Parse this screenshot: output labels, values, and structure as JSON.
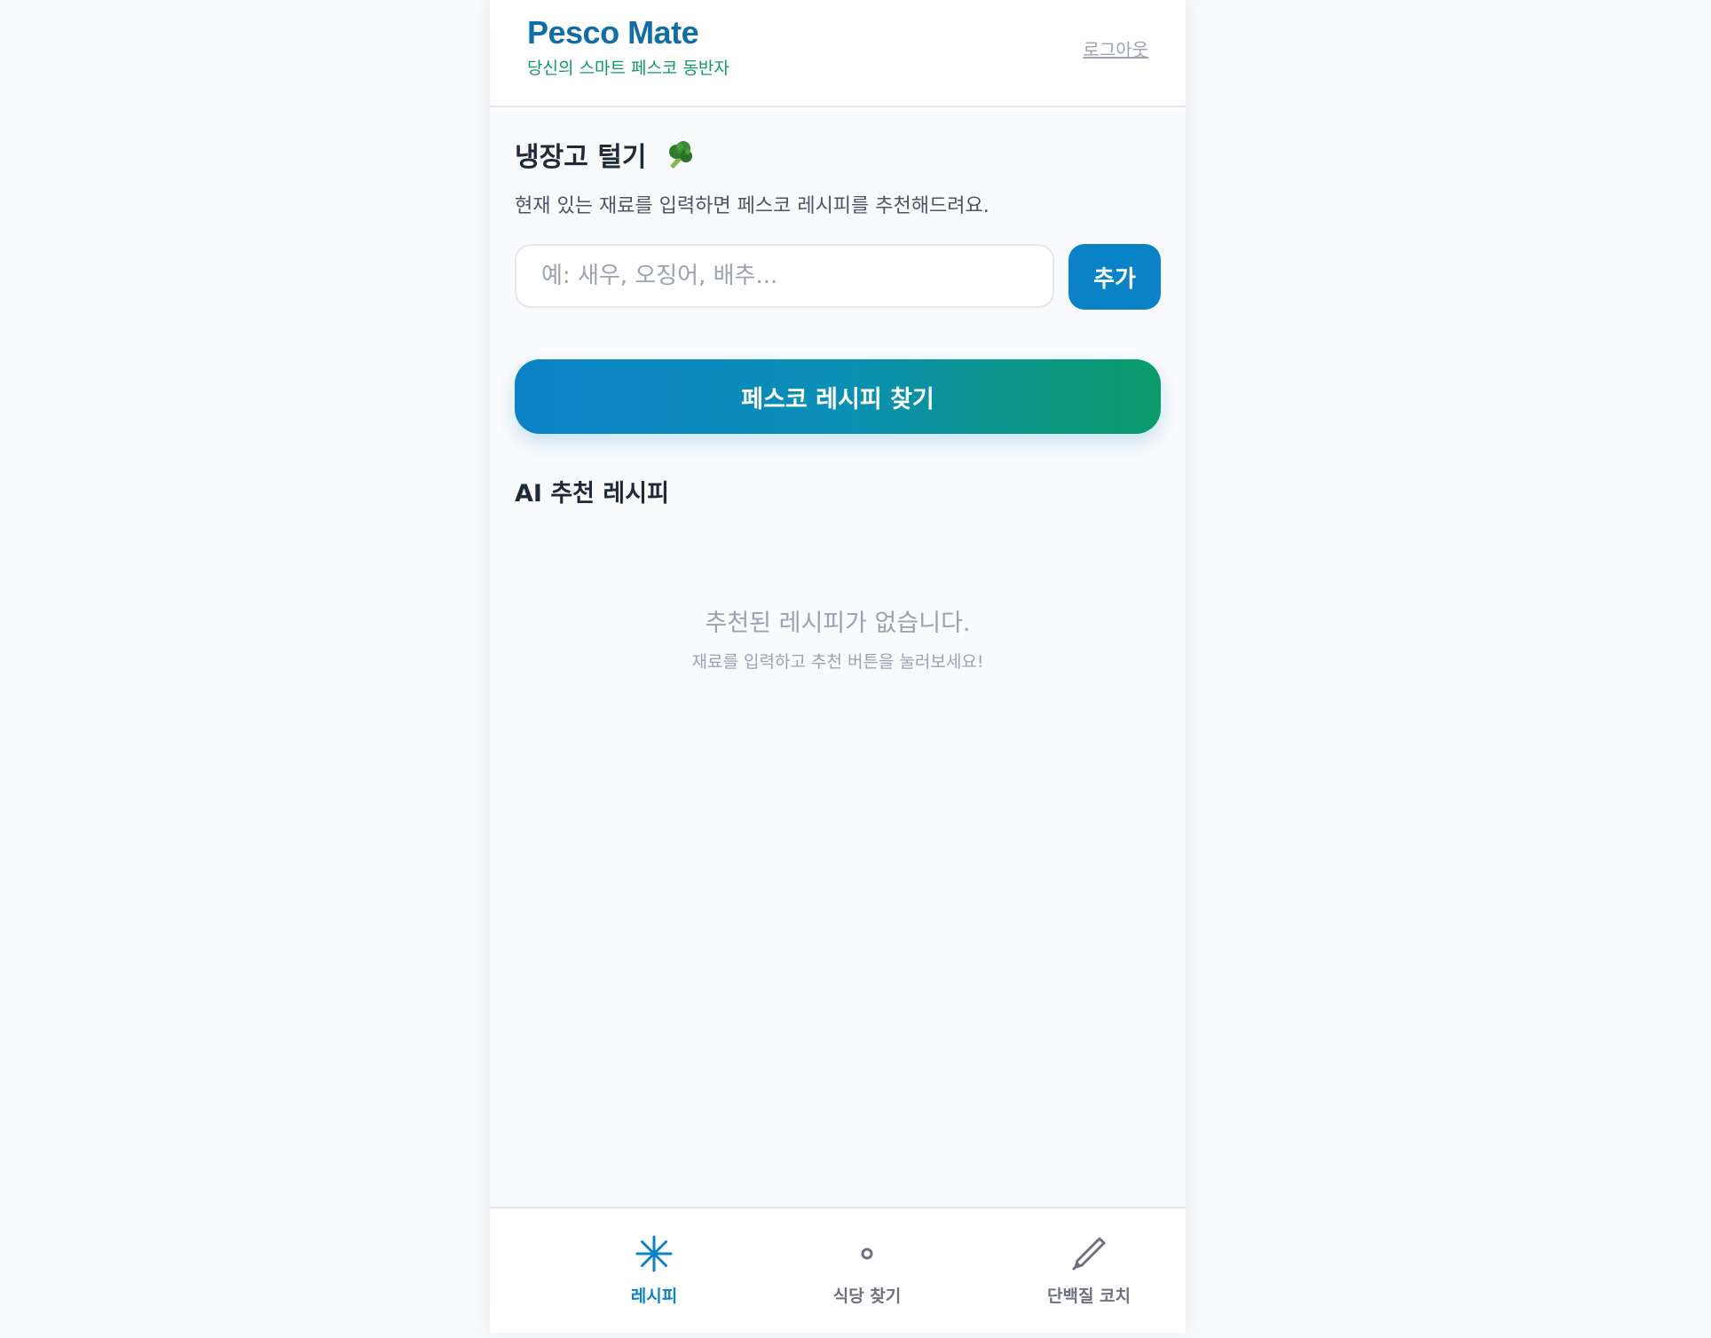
{
  "header": {
    "title": "Pesco Mate",
    "subtitle": "당신의 스마트 페스코 동반자",
    "logout_label": "로그아웃"
  },
  "fridge": {
    "title": "냉장고 털기",
    "title_icon": "broccoli-icon",
    "description": "현재 있는 재료를 입력하면 페스코 레시피를 추천해드려요.",
    "input_placeholder": "예: 새우, 오징어, 배추...",
    "input_value": "",
    "add_label": "추가",
    "find_label": "페스코 레시피 찾기"
  },
  "recommendations": {
    "title": "AI 추천 레시피",
    "empty_message": "추천된 레시피가 없습니다.",
    "empty_hint": "재료를 입력하고 추천 버튼을 눌러보세요!"
  },
  "bottom_nav": {
    "items": [
      {
        "label": "레시피",
        "icon": "asterisk-icon",
        "active": true
      },
      {
        "label": "식당 찾기",
        "icon": "circle-icon",
        "active": false
      },
      {
        "label": "단백질 코치",
        "icon": "pen-icon",
        "active": false
      }
    ]
  },
  "colors": {
    "brand_blue": "#0f6ea8",
    "brand_green": "#0f9b5f",
    "accent_blue": "#0a82c7",
    "gradient_end": "#0a9c68",
    "muted_text": "#9ca3af",
    "background": "#f8fafc"
  }
}
